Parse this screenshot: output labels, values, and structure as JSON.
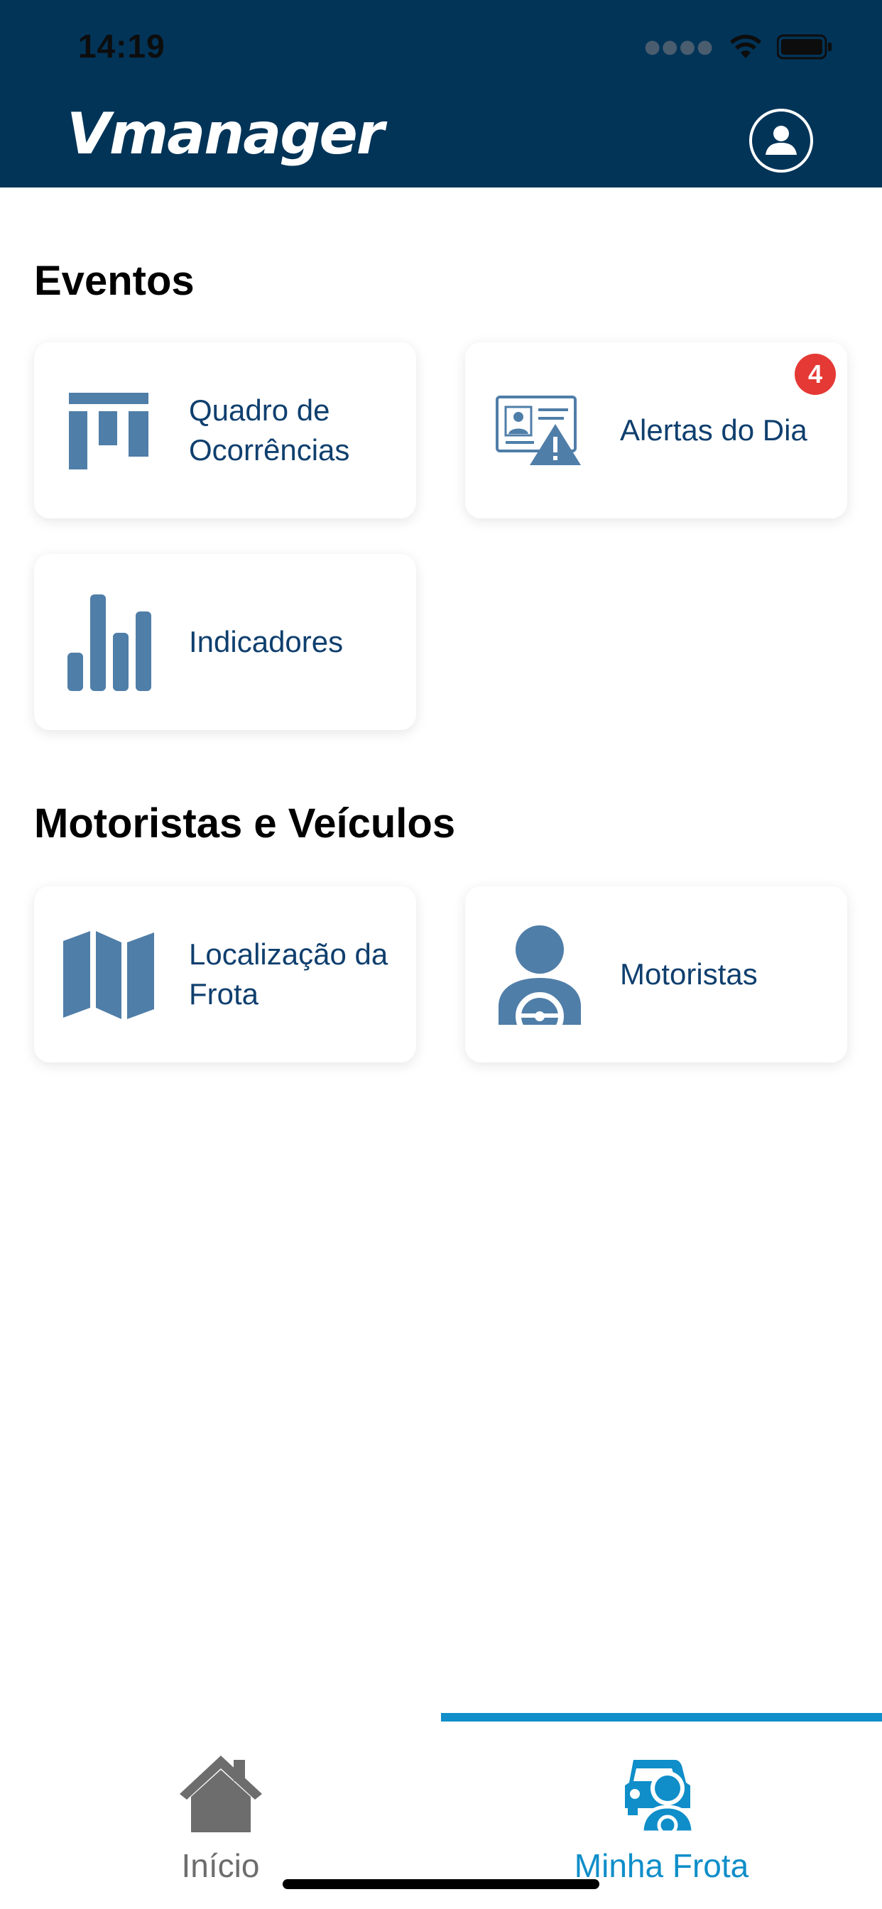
{
  "status_bar": {
    "time": "14:19"
  },
  "header": {
    "logo": "Vmanager"
  },
  "sections": {
    "eventos": {
      "title": "Eventos",
      "cards": [
        {
          "label": "Quadro de Ocorrências",
          "icon": "board-icon"
        },
        {
          "label": "Alertas do Dia",
          "icon": "alert-card-icon",
          "badge": "4"
        },
        {
          "label": "Indicadores",
          "icon": "bar-chart-icon"
        }
      ]
    },
    "motoristas": {
      "title": "Motoristas e Veículos",
      "cards": [
        {
          "label": "Localização da Frota",
          "icon": "map-icon"
        },
        {
          "label": "Motoristas",
          "icon": "driver-icon"
        }
      ]
    }
  },
  "tabbar": {
    "tabs": [
      {
        "label": "Início",
        "icon": "home-icon",
        "active": false
      },
      {
        "label": "Minha Frota",
        "icon": "fleet-icon",
        "active": true
      }
    ]
  },
  "colors": {
    "header_bg": "#023458",
    "icon_blue": "#4f7ea8",
    "label_blue": "#0f3f6e",
    "badge_red": "#e53935",
    "active_tab": "#0f8ec9",
    "inactive_tab": "#6d6d6d"
  }
}
